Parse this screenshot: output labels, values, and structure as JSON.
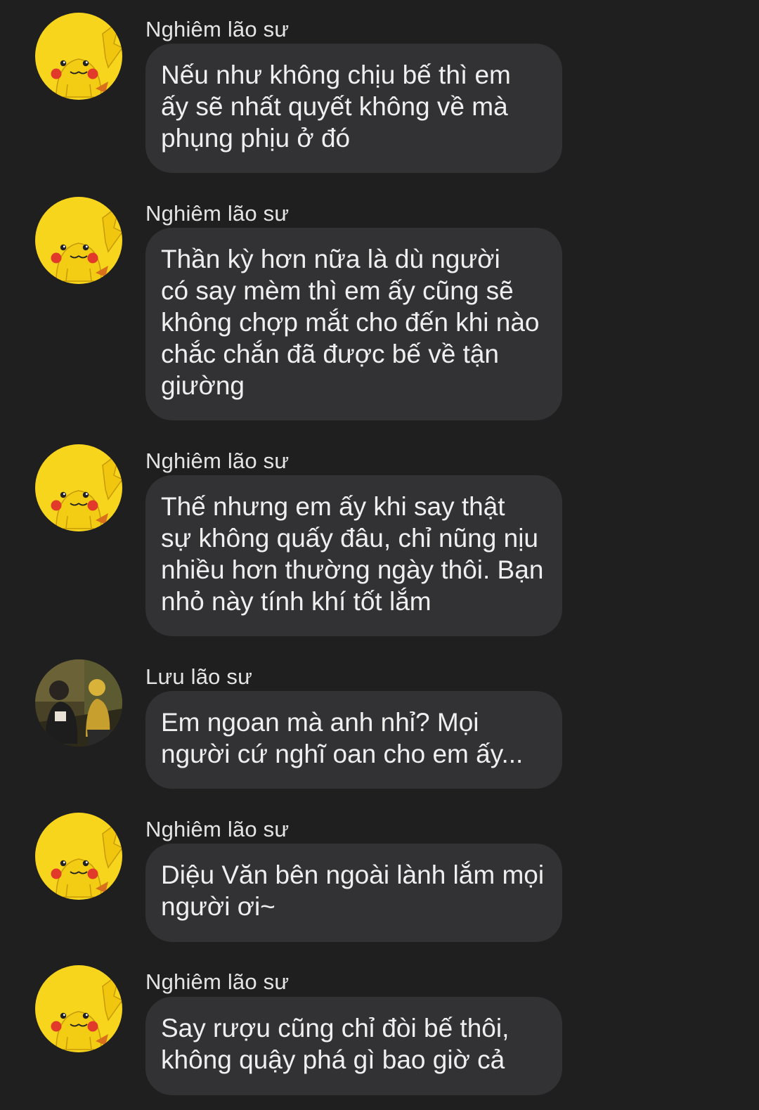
{
  "messages": [
    {
      "sender": "Nghiêm lão sư",
      "avatar": "pikachu-avatar",
      "text": "Nếu như không chịu bế thì em\nấy sẽ nhất quyết không về mà\nphụng phịu ở đó"
    },
    {
      "sender": "Nghiêm lão sư",
      "avatar": "pikachu-avatar",
      "text": "Thần kỳ hơn nữa là dù người\ncó say mèm thì em ấy cũng sẽ\nkhông chợp mắt cho đến khi nào\nchắc chắn đã được bế về tận\ngiường"
    },
    {
      "sender": "Nghiêm lão sư",
      "avatar": "pikachu-avatar",
      "text": "Thế nhưng em ấy khi say thật\nsự không quấy đâu, chỉ nũng nịu\nnhiều hơn thường ngày thôi. Bạn\nnhỏ này tính khí tốt lắm"
    },
    {
      "sender": "Lưu lão sư",
      "avatar": "photo-avatar",
      "text": "Em ngoan mà anh nhỉ? Mọi\nngười cứ nghĩ oan cho em ấy..."
    },
    {
      "sender": "Nghiêm lão sư",
      "avatar": "pikachu-avatar",
      "text": "Diệu Văn bên ngoài lành lắm mọi\nngười ơi~"
    },
    {
      "sender": "Nghiêm lão sư",
      "avatar": "pikachu-avatar",
      "text": "Say rượu cũng chỉ đòi bế thôi,\nkhông quậy phá gì bao giờ cả"
    }
  ],
  "colors": {
    "background": "#1f1f1f",
    "bubble": "#323234",
    "text": "#efefef",
    "pikachu_yellow": "#f7d51d"
  }
}
